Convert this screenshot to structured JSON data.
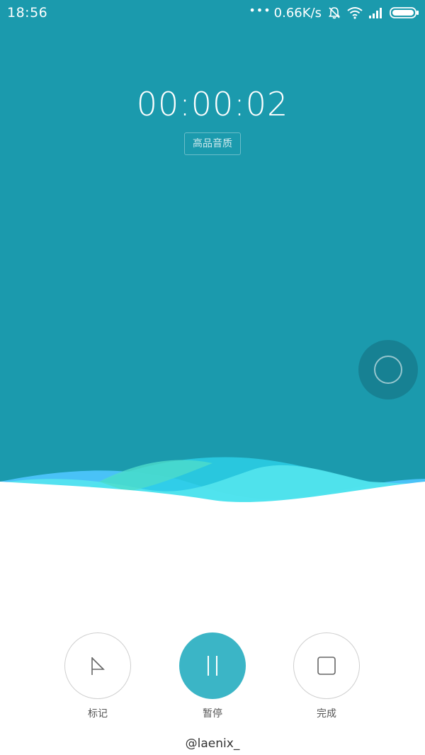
{
  "status_bar": {
    "time": "18:56",
    "dots": "•••",
    "net_speed": "0.66K/s",
    "icons": [
      "alarm-off-icon",
      "wifi-icon",
      "signal-icon",
      "battery-icon"
    ]
  },
  "recorder": {
    "timer": "00:00:02",
    "quality": "高品音质"
  },
  "controls": {
    "mark_label": "标记",
    "pause_label": "暂停",
    "done_label": "完成",
    "icons": [
      "flag-icon",
      "pause-icon",
      "stop-icon"
    ]
  },
  "watermark": "@laenix_",
  "colors": {
    "background_top": "#1b9aad",
    "accent": "#3bb5c6",
    "wave_cyan": "#56e6ee",
    "wave_blue": "#4fc6ff",
    "wave_green": "#4ddccb"
  }
}
